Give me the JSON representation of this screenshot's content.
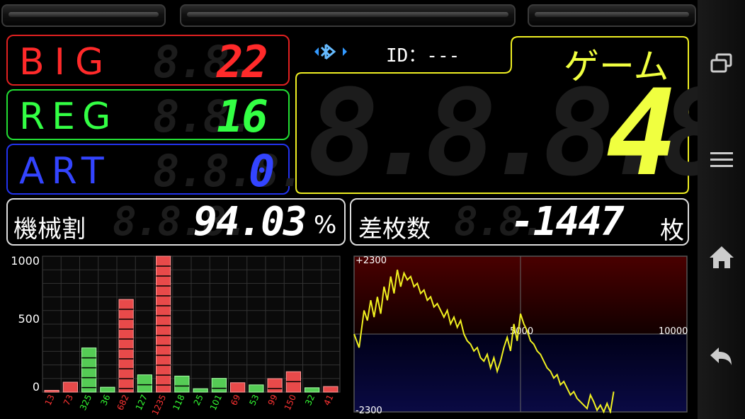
{
  "counters": {
    "big": {
      "label": "BIG",
      "value": "22",
      "ghost": "8.8.",
      "color": "#ff2a2a"
    },
    "reg": {
      "label": "REG",
      "value": "16",
      "ghost": "8.8.",
      "color": "#33ff44"
    },
    "art": {
      "label": "ART",
      "value": "0",
      "ghost": "8.8.8.",
      "color": "#3344ff"
    }
  },
  "status": {
    "id_label": "ID：---",
    "bluetooth_icon": "bluetooth-icon"
  },
  "game": {
    "label": "ゲーム",
    "value": "4",
    "ghost": "8.8.8.8.",
    "color": "#f0ff40"
  },
  "payout": {
    "label": "機械割",
    "value": "94.03",
    "unit": "%",
    "ghost": "8.8.8."
  },
  "difference": {
    "label": "差枚数",
    "value": "-1447",
    "unit": "枚",
    "ghost": "8.8."
  },
  "chart_data": [
    {
      "type": "bar",
      "ylim": [
        0,
        1000
      ],
      "yticks": [
        "1000",
        "500",
        "0"
      ],
      "categories": [
        "13",
        "73",
        "325",
        "36",
        "682",
        "127",
        "1235",
        "118",
        "25",
        "101",
        "69",
        "53",
        "99",
        "150",
        "32",
        "41"
      ],
      "values": [
        13,
        73,
        325,
        36,
        682,
        127,
        1235,
        118,
        25,
        101,
        69,
        53,
        99,
        150,
        32,
        41
      ],
      "bar_colors": [
        "red",
        "red",
        "green",
        "green",
        "red",
        "green",
        "red",
        "green",
        "green",
        "green",
        "red",
        "green",
        "red",
        "red",
        "green",
        "red"
      ]
    },
    {
      "type": "line",
      "ylim": [
        -2300,
        2300
      ],
      "xlim": [
        0,
        10000
      ],
      "labels": {
        "ymax": "+2300",
        "ymin": "-2300",
        "xmid": "5000",
        "xmax": "10000"
      },
      "x": [
        0,
        150,
        300,
        400,
        500,
        600,
        700,
        800,
        900,
        1000,
        1100,
        1200,
        1300,
        1400,
        1500,
        1600,
        1700,
        1800,
        1900,
        2000,
        2100,
        2200,
        2300,
        2400,
        2500,
        2600,
        2700,
        2800,
        2900,
        3000,
        3100,
        3200,
        3300,
        3400,
        3500,
        3600,
        3700,
        3800,
        3900,
        4000,
        4100,
        4200,
        4300,
        4400,
        4500,
        4600,
        4700,
        4800,
        4900,
        5000,
        5100,
        5200,
        5300,
        5400,
        5500,
        5600,
        5700,
        5800,
        5900,
        6000,
        6100,
        6200,
        6300,
        6400,
        6500,
        6600,
        6700,
        6800,
        6900,
        7000,
        7100,
        7200,
        7300,
        7400,
        7500,
        7600,
        7700,
        7800
      ],
      "y": [
        0,
        -400,
        700,
        400,
        1000,
        500,
        1100,
        600,
        1400,
        1000,
        1700,
        1200,
        1900,
        1400,
        1800,
        1600,
        1700,
        1400,
        1500,
        1200,
        1300,
        1000,
        1100,
        800,
        900,
        700,
        500,
        700,
        300,
        500,
        200,
        400,
        0,
        -200,
        -300,
        -500,
        -400,
        -700,
        -800,
        -600,
        -1000,
        -700,
        -1100,
        -800,
        -400,
        -100,
        -500,
        300,
        -200,
        600,
        300,
        100,
        -200,
        -300,
        -500,
        -600,
        -800,
        -1000,
        -1100,
        -1300,
        -1200,
        -1500,
        -1400,
        -1600,
        -1800,
        -1700,
        -1900,
        -2000,
        -2100,
        -2200,
        -1800,
        -2000,
        -2250,
        -2100,
        -2300,
        -2050,
        -2300,
        -1700
      ]
    }
  ],
  "nav": {
    "icons": [
      "recent-apps-icon",
      "menu-icon",
      "home-icon",
      "back-icon"
    ]
  }
}
